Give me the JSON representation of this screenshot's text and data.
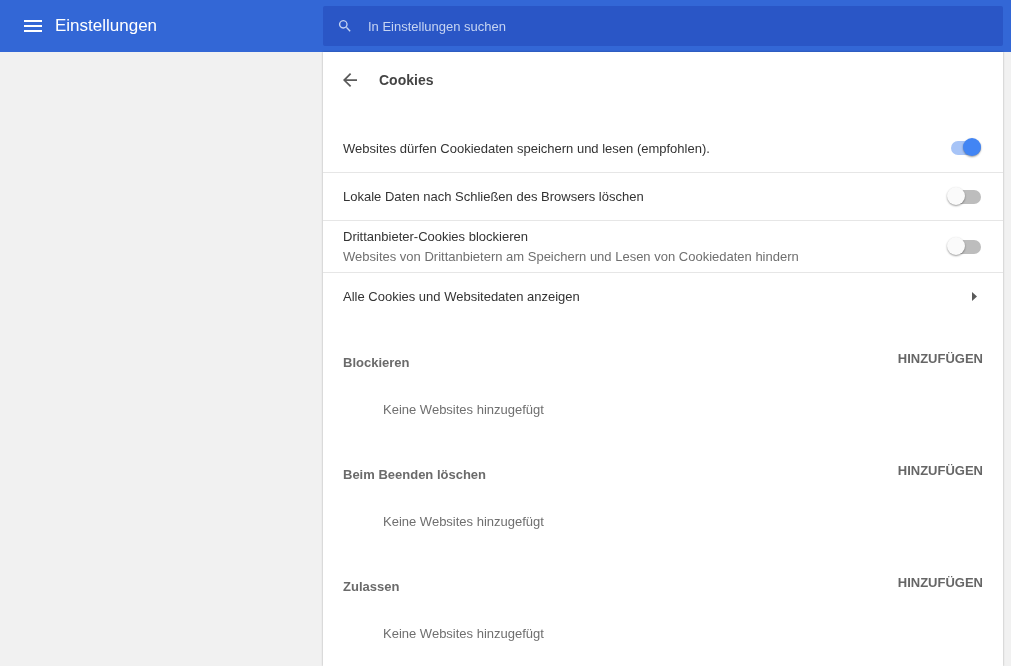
{
  "header": {
    "title": "Einstellungen",
    "search": {
      "placeholder": "In Einstellungen suchen"
    }
  },
  "page": {
    "title": "Cookies"
  },
  "settings": [
    {
      "kind": "toggle",
      "label": "Websites dürfen Cookiedaten speichern und lesen (empfohlen).",
      "on": true
    },
    {
      "kind": "toggle",
      "label": "Lokale Daten nach Schließen des Browsers löschen",
      "on": false
    },
    {
      "kind": "toggle",
      "label": "Drittanbieter-Cookies blockieren",
      "description": "Websites von Drittanbietern am Speichern und Lesen von Cookiedaten hindern",
      "on": false
    },
    {
      "kind": "link",
      "label": "Alle Cookies und Websitedaten anzeigen"
    }
  ],
  "sections": [
    {
      "title": "Blockieren",
      "action": "HINZUFÜGEN",
      "empty_text": "Keine Websites hinzugefügt"
    },
    {
      "title": "Beim Beenden löschen",
      "action": "HINZUFÜGEN",
      "empty_text": "Keine Websites hinzugefügt"
    },
    {
      "title": "Zulassen",
      "action": "HINZUFÜGEN",
      "empty_text": "Keine Websites hinzugefügt"
    }
  ]
}
